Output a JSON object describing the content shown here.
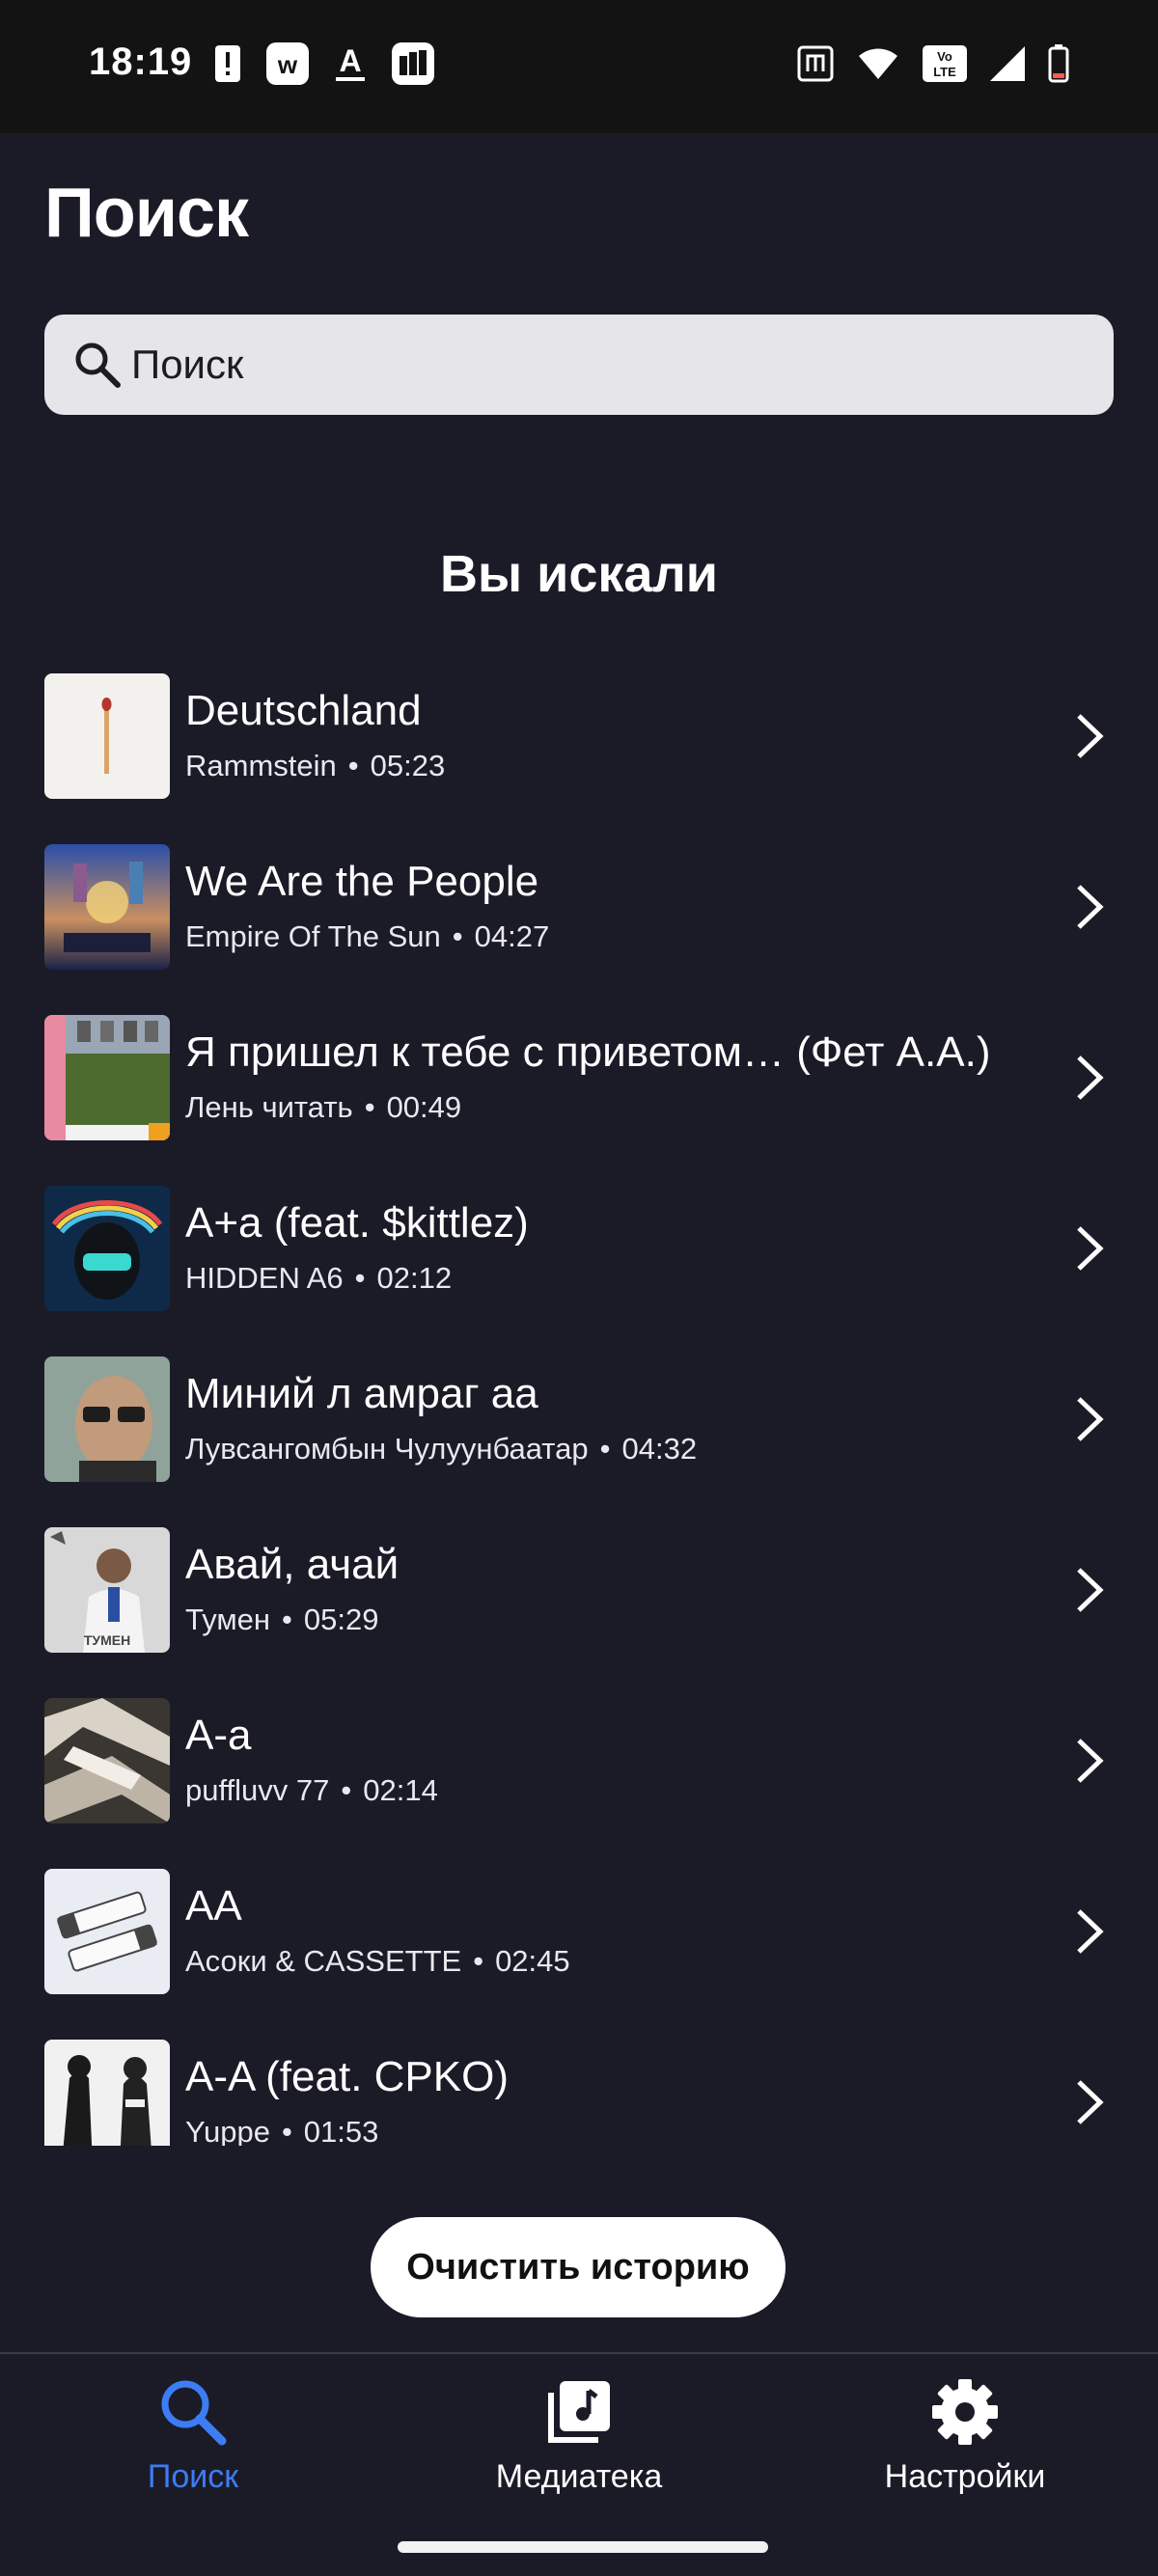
{
  "status_bar": {
    "time": "18:19",
    "left_icons": [
      "alert-icon",
      "w-app-icon",
      "text-a-icon",
      "film-app-icon"
    ],
    "right_icons": [
      "nfc-icon",
      "wifi-icon",
      "volte-icon",
      "signal-icon",
      "battery-icon"
    ]
  },
  "header": {
    "title": "Поиск",
    "search_placeholder": "Поиск"
  },
  "history": {
    "title": "Вы искали",
    "items": [
      {
        "title": "Deutschland",
        "artist": "Rammstein",
        "duration": "05:23",
        "cover": "matchstick-cover"
      },
      {
        "title": "We Are the People",
        "artist": "Empire Of The Sun",
        "duration": "04:27",
        "cover": "empire-cover"
      },
      {
        "title": "Я пришел к тебе с приветом… (Фет А.А.)",
        "artist": "Лень читать",
        "duration": "00:49",
        "cover": "literature-cover"
      },
      {
        "title": "A+a (feat. $kittlez)",
        "artist": "HIDDEN A6",
        "duration": "02:12",
        "cover": "hooded-cover"
      },
      {
        "title": "Миний л амраг аа",
        "artist": "Лувсангомбын Чулуунбаатар",
        "duration": "04:32",
        "cover": "man-glasses-cover"
      },
      {
        "title": "Авай, ачай",
        "artist": "Тумен",
        "duration": "05:29",
        "cover": "tumen-cover",
        "cover_text": "ТУМЕН"
      },
      {
        "title": "A-a",
        "artist": "puffluvv 77",
        "duration": "02:14",
        "cover": "abstract-cover"
      },
      {
        "title": "AA",
        "artist": "Асоки & CASSETTE",
        "duration": "02:45",
        "cover": "batteries-cover"
      },
      {
        "title": "A-A (feat. CPKO)",
        "artist": "Yuppe",
        "duration": "01:53",
        "cover": "bw-figures-cover"
      }
    ],
    "separator": "•"
  },
  "clear_button": "Очистить историю",
  "bottom_nav": {
    "items": [
      {
        "label": "Поиск",
        "icon": "search-icon",
        "active": true
      },
      {
        "label": "Медиатека",
        "icon": "library-icon",
        "active": false
      },
      {
        "label": "Настройки",
        "icon": "settings-icon",
        "active": false
      }
    ]
  },
  "colors": {
    "background": "#1b1b28",
    "status_bar": "#131313",
    "search_field": "#e5e5ea",
    "accent": "#3c7cf5",
    "button_bg": "#ffffff"
  }
}
